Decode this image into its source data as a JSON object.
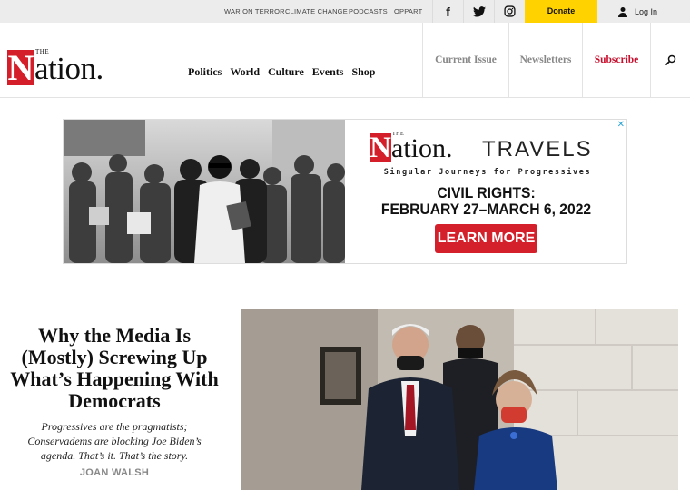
{
  "topbar": {
    "links": [
      "War on Terror",
      "Climate Change",
      "Podcasts",
      "OppArt"
    ],
    "social": [
      {
        "icon": "facebook-icon",
        "glyph": "f"
      },
      {
        "icon": "twitter-icon"
      },
      {
        "icon": "instagram-icon"
      }
    ],
    "donate_label": "Donate",
    "login_label": "Log In"
  },
  "header": {
    "logo": {
      "the": "THE",
      "initial": "N",
      "rest": "ation."
    },
    "nav": [
      "Politics",
      "World",
      "Culture",
      "Events",
      "Shop"
    ],
    "current_issue": "Current Issue",
    "newsletters": "Newsletters",
    "subscribe": "Subscribe"
  },
  "ad": {
    "logo": {
      "the": "THE",
      "initial": "N",
      "rest": "ation.",
      "suffix": "TRAVELS"
    },
    "tagline": "Singular Journeys for Progressives",
    "event_line1": "CIVIL RIGHTS:",
    "event_line2": "FEBRUARY 27–MARCH 6, 2022",
    "cta": "LEARN MORE",
    "close": "✕"
  },
  "feature": {
    "headline": "Why the Media Is (Mostly) Screwing Up What’s Happening With Democrats",
    "dek": "Progressives are the pragmatists; Conservadems are blocking Joe Biden’s agenda. That’s it. That’s the story.",
    "byline": "JOAN WALSH"
  },
  "colors": {
    "brand_red": "#d41f2a",
    "donate_yellow": "#ffd200",
    "subscribe_red": "#c8102e"
  }
}
